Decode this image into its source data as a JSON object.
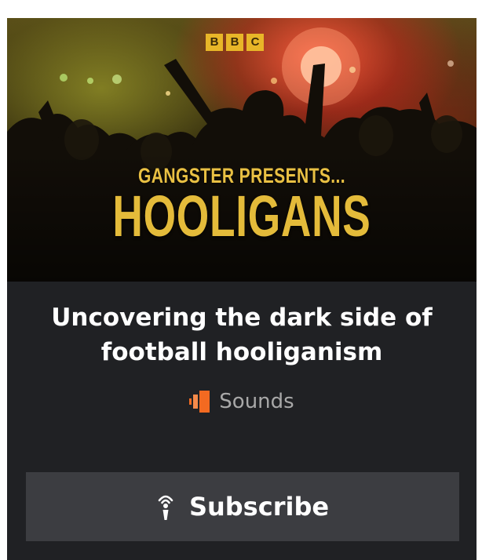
{
  "artwork": {
    "logo_letters": [
      "B",
      "B",
      "C"
    ],
    "pretitle": "GANGSTER PRESENTS...",
    "title": "HOOLIGANS"
  },
  "headline": "Uncovering the dark side of football hooliganism",
  "source": {
    "label": "Sounds",
    "icon": "bbc-sounds-icon"
  },
  "subscribe": {
    "label": "Subscribe",
    "icon": "podcast-icon"
  },
  "colors": {
    "card_background": "#202124",
    "button_background": "#3c3d41",
    "headline_text": "#ffffff",
    "source_text": "#a8a8a8",
    "sounds_orange": "#f36a21",
    "title_gold": "#e4bb3a"
  }
}
